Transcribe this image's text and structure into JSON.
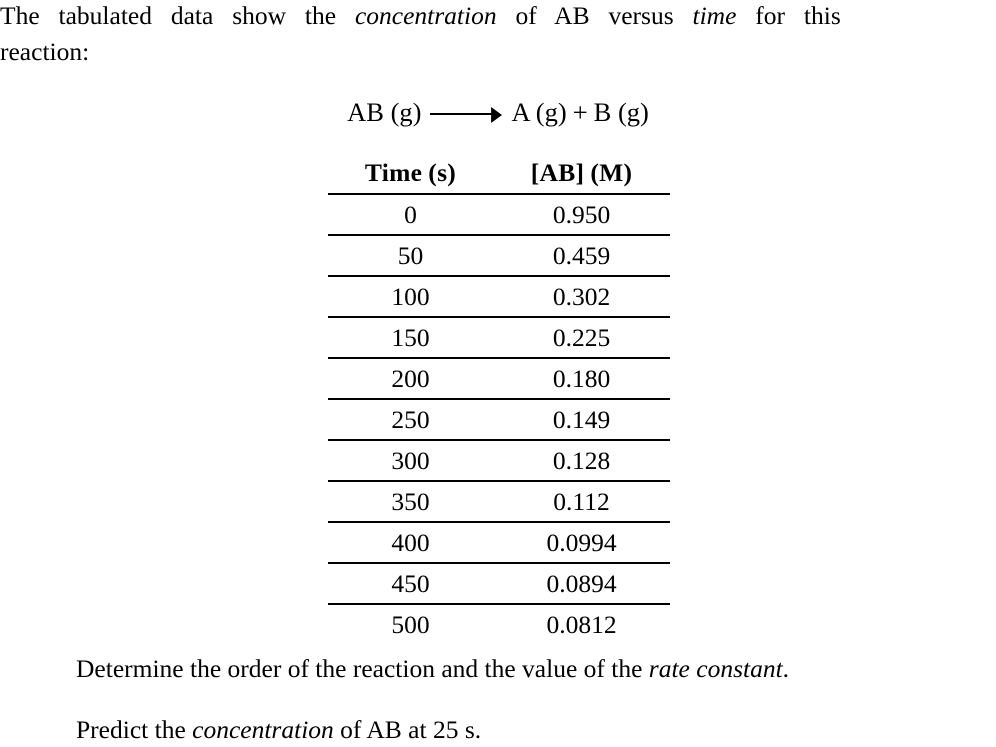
{
  "intro": {
    "line1_a": "The tabulated data show the ",
    "line1_em": "concentration",
    "line1_b": " of AB versus ",
    "line1_em2": "time",
    "line1_c": " for this",
    "line2": "reaction:"
  },
  "equation": {
    "reactant": "AB (g)",
    "arrow_symbol": "⟶",
    "product_1": "A (g)",
    "plus": "+",
    "product_2": "B (g)",
    "full_text": "AB (g) ⟶ A (g) + B (g)"
  },
  "table": {
    "headers": [
      "Time  (s)",
      "[AB]  (M)"
    ],
    "header_time": "Time",
    "header_time_unit": "(s)",
    "header_conc": "[AB]",
    "header_conc_unit": "(M)",
    "rows": [
      {
        "time": "0",
        "conc": "0.950"
      },
      {
        "time": "50",
        "conc": "0.459"
      },
      {
        "time": "100",
        "conc": "0.302"
      },
      {
        "time": "150",
        "conc": "0.225"
      },
      {
        "time": "200",
        "conc": "0.180"
      },
      {
        "time": "250",
        "conc": "0.149"
      },
      {
        "time": "300",
        "conc": "0.128"
      },
      {
        "time": "350",
        "conc": "0.112"
      },
      {
        "time": "400",
        "conc": "0.0994"
      },
      {
        "time": "450",
        "conc": "0.0894"
      },
      {
        "time": "500",
        "conc": "0.0812"
      }
    ]
  },
  "questions": {
    "q1_a": "Determine the order of the reaction and the value of the ",
    "q1_em": "rate constant",
    "q1_b": ".",
    "q2_a": "Predict the ",
    "q2_em": "concentration",
    "q2_b": " of AB at 25 s."
  },
  "chart_data": {
    "type": "table",
    "title": "Concentration of AB versus time",
    "xlabel": "Time (s)",
    "ylabel": "[AB] (M)",
    "categories": [
      0,
      50,
      100,
      150,
      200,
      250,
      300,
      350,
      400,
      450,
      500
    ],
    "series": [
      {
        "name": "[AB] (M)",
        "values": [
          0.95,
          0.459,
          0.302,
          0.225,
          0.18,
          0.149,
          0.128,
          0.112,
          0.0994,
          0.0894,
          0.0812
        ]
      }
    ],
    "columns": [
      "Time  (s)",
      "[AB]  (M)"
    ],
    "grid": false,
    "legend": "none"
  },
  "colors": {
    "text": "#000000",
    "background": "#ffffff",
    "rule": "#000000"
  }
}
